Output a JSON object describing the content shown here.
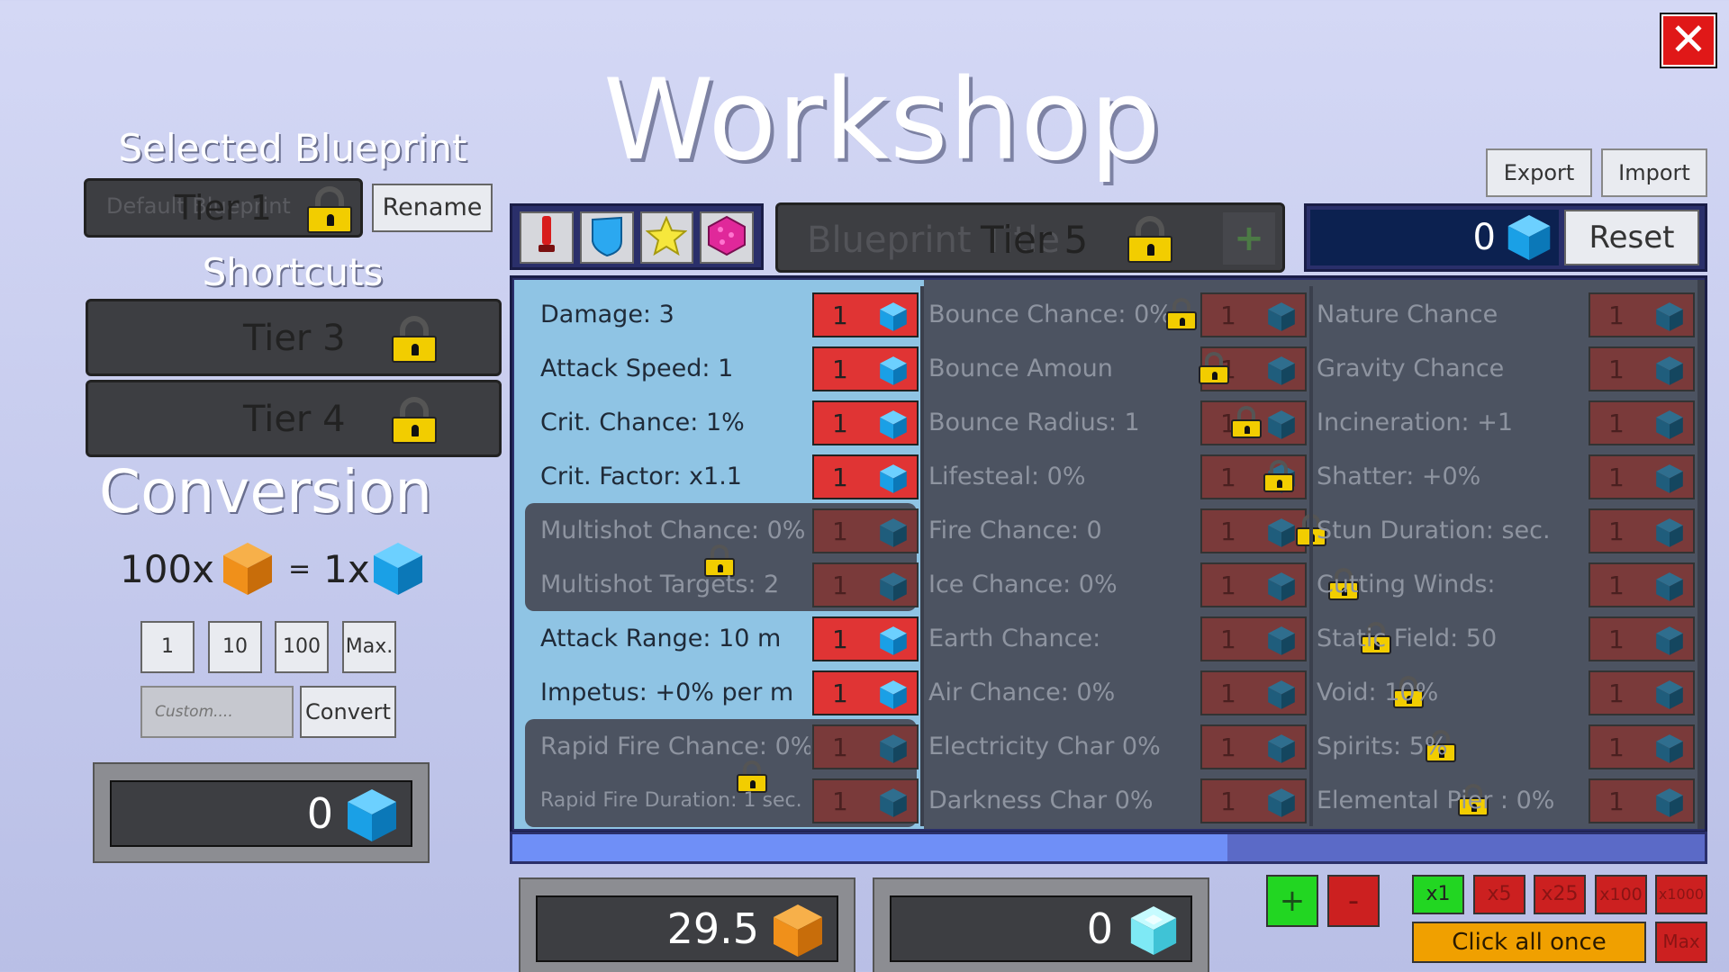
{
  "title": "Workshop",
  "close_icon": "close-icon",
  "header_buttons": {
    "export": "Export",
    "import": "Import"
  },
  "selected_blueprint": {
    "heading": "Selected Blueprint",
    "placeholder": "Default Blueprint",
    "tier": "Tier 1",
    "rename": "Rename"
  },
  "shortcuts": {
    "heading": "Shortcuts",
    "items": [
      {
        "label": "Tier 3"
      },
      {
        "label": "Tier 4"
      }
    ]
  },
  "conversion": {
    "heading": "Conversion",
    "from_amount": "100x",
    "equals": "=",
    "to_amount": "1x",
    "quantity_buttons": [
      "1",
      "10",
      "100",
      "Max."
    ],
    "custom_placeholder": "Custom....",
    "convert": "Convert",
    "result_value": "0"
  },
  "blueprint_bar": {
    "placeholder": "Blueprint Title",
    "tier": "Tier 5",
    "add_icon": "plus-icon"
  },
  "currency": {
    "value": "0",
    "reset": "Reset"
  },
  "category_icons": [
    "damage-icon",
    "shield-icon",
    "star-icon",
    "gem-icon"
  ],
  "stats": {
    "col1": [
      {
        "label": "Damage: 3",
        "cost": "1",
        "locked": false
      },
      {
        "label": "Attack Speed: 1",
        "cost": "1",
        "locked": false
      },
      {
        "label": "Crit. Chance: 1%",
        "cost": "1",
        "locked": false
      },
      {
        "label": "Crit. Factor: x1.1",
        "cost": "1",
        "locked": false
      },
      {
        "label": "Multishot Chance: 0%",
        "cost": "1",
        "locked": true
      },
      {
        "label": "Multishot Targets: 2",
        "cost": "1",
        "locked": true
      },
      {
        "label": "Attack Range: 10 m",
        "cost": "1",
        "locked": false
      },
      {
        "label": "Impetus: +0% per m",
        "cost": "1",
        "locked": false
      },
      {
        "label": "Rapid Fire Chance: 0%",
        "cost": "1",
        "locked": true
      },
      {
        "label": "Rapid Fire Duration: 1 sec.",
        "cost": "1",
        "locked": true
      }
    ],
    "col2": [
      {
        "label": "Bounce Chance: 0%",
        "cost": "1"
      },
      {
        "label": "Bounce Amoun",
        "cost": "1"
      },
      {
        "label": "Bounce Radius: 1",
        "cost": "1"
      },
      {
        "label": "Lifesteal: 0%",
        "cost": "1"
      },
      {
        "label": "Fire Chance: 0",
        "cost": "1"
      },
      {
        "label": "Ice Chance: 0%",
        "cost": "1"
      },
      {
        "label": "Earth Chance: ",
        "cost": "1"
      },
      {
        "label": "Air Chance: 0%",
        "cost": "1"
      },
      {
        "label": "Electricity Char      0%",
        "cost": "1"
      },
      {
        "label": "Darkness Char      0%",
        "cost": "1"
      }
    ],
    "col3": [
      {
        "label": "Nature Chance      ",
        "cost": "1"
      },
      {
        "label": "Gravity Chance     ",
        "cost": "1"
      },
      {
        "label": "Incineration: +1",
        "cost": "1"
      },
      {
        "label": "Shatter: +0%",
        "cost": "1"
      },
      {
        "label": "Stun Duration:      sec.",
        "cost": "1"
      },
      {
        "label": "Cutting Winds: ",
        "cost": "1"
      },
      {
        "label": "Static Field: 50",
        "cost": "1"
      },
      {
        "label": "Void: 10%",
        "cost": "1"
      },
      {
        "label": "Spirits: 5%",
        "cost": "1"
      },
      {
        "label": "Elemental Pier      : 0%",
        "cost": "1"
      }
    ]
  },
  "progress": {
    "fraction": 0.6
  },
  "resources": [
    {
      "value": "29.5",
      "icon": "orange-cube-icon"
    },
    {
      "value": "0",
      "icon": "cyan-crystal-icon"
    }
  ],
  "controls": {
    "plus": "+",
    "minus": "-",
    "multipliers": [
      "x1",
      "x5",
      "x25",
      "x100",
      "x1000"
    ],
    "click_all": "Click all once",
    "max": "Max"
  },
  "colors": {
    "accent_red": "#e03434",
    "cube_blue": "#1aa0e6",
    "cube_orange": "#f0901a",
    "panel_blue": "#8fc4e4",
    "panel_dark": "#4c5361"
  }
}
